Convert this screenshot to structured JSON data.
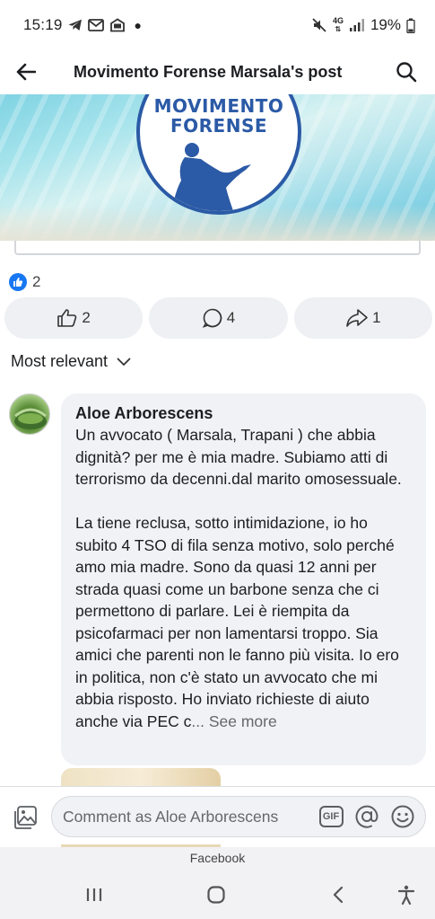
{
  "status_bar": {
    "time": "15:19",
    "network": "4G",
    "battery": "19%",
    "icons": [
      "telegram-icon",
      "gmail-icon",
      "inbox-icon",
      "mute-icon",
      "signal-icon",
      "battery-icon"
    ]
  },
  "header": {
    "title": "Movimento Forense Marsala's post"
  },
  "post": {
    "logo_line1": "MOVIMENTO",
    "logo_line2": "FORENSE"
  },
  "reactions": {
    "summary_count": "2",
    "like_count": "2",
    "comment_count": "4",
    "share_count": "1"
  },
  "sort": {
    "label": "Most relevant"
  },
  "comment": {
    "author": "Aloe Arborescens",
    "paragraph1": "Un avvocato ( Marsala, Trapani ) che abbia dignità? per me è mia madre. Subiamo atti di terrorismo da decenni.dal marito omosessuale.",
    "paragraph2": "La tiene reclusa, sotto intimidazione, io ho subito 4 TSO di fila senza motivo, solo perché amo mia madre. Sono da quasi 12 anni per strada quasi come un barbone senza che ci permettono di parlare. Lei è riempita da psicofarmaci per non lamentarsi troppo. Sia amici che parenti non le fanno più visita. Io ero in politica, non c'è stato un avvocato che mi abbia risposto. Ho inviato richieste di aiuto anche via PEC c",
    "ellipsis": "...",
    "see_more": " See more"
  },
  "composer": {
    "placeholder": "Comment as Aloe Arborescens",
    "gif_label": "GIF"
  },
  "system": {
    "app_label": "Facebook"
  },
  "colors": {
    "facebook_blue": "#1877f2",
    "logo_blue": "#2b5aa6",
    "bubble_bg": "#f0f2f5"
  }
}
